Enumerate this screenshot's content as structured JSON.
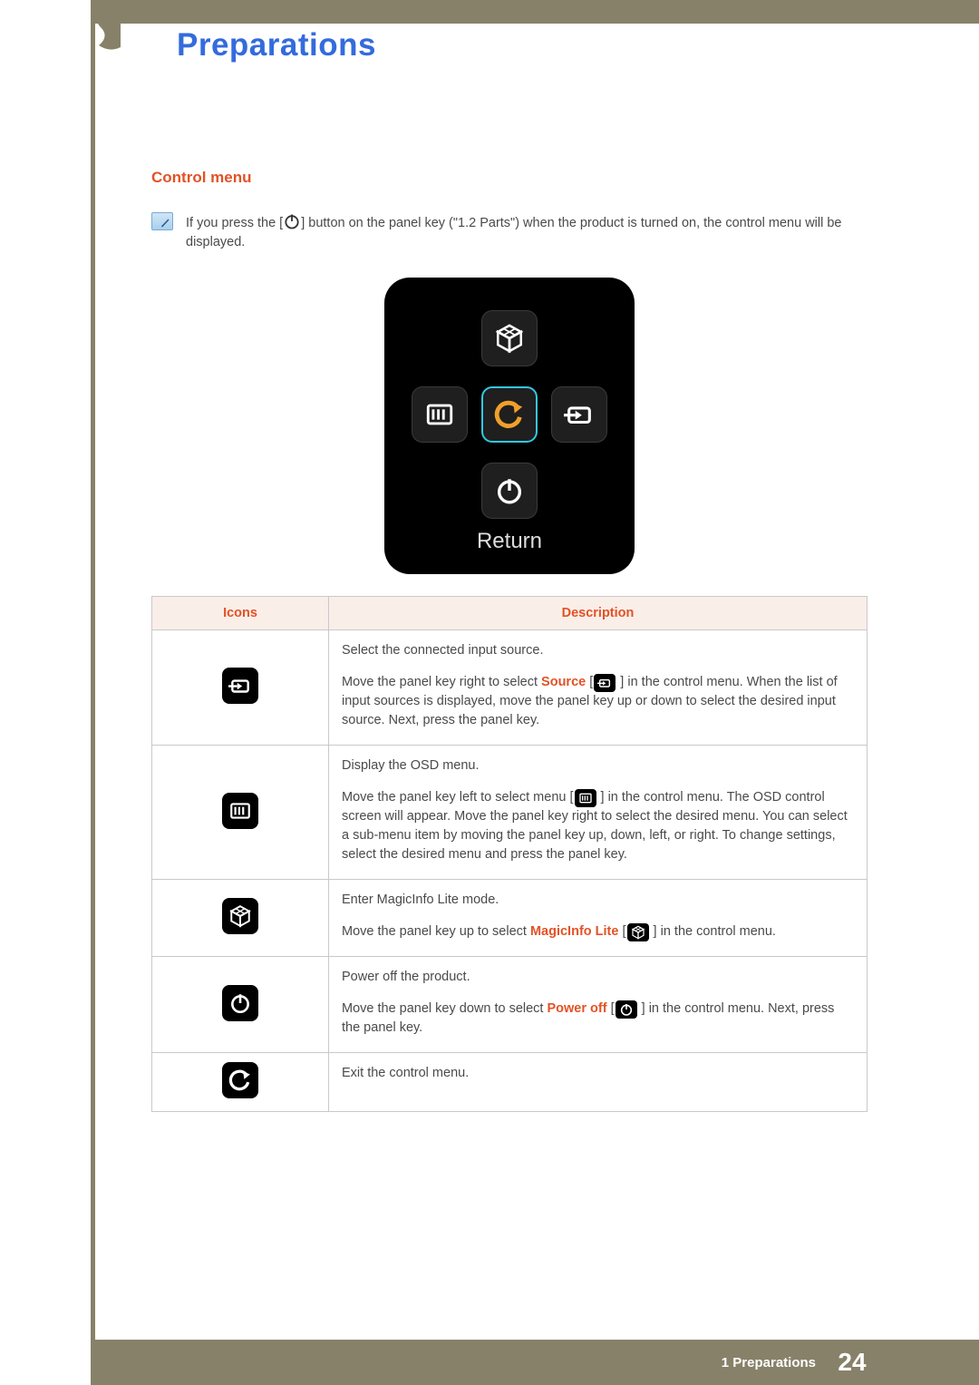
{
  "chapter_title": "Preparations",
  "section_title": "Control menu",
  "note": {
    "pre": "If you press the [",
    "post": "] button on the panel key (\"1.2 Parts\") when the product is turned on, the control menu will be displayed."
  },
  "control_panel": {
    "return_label": "Return"
  },
  "table": {
    "headers": {
      "icons": "Icons",
      "description": "Description"
    },
    "rows": [
      {
        "icon": "source",
        "line1": "Select the connected input source.",
        "pre": "Move the panel key right to select ",
        "hl": "Source",
        "post": " ] in the control menu. When the list of input sources is displayed, move the panel key up or down to select the desired input source. Next, press the panel key."
      },
      {
        "icon": "menu",
        "line1": "Display the OSD menu.",
        "pre": "Move the panel key left to select menu [",
        "post": " ] in the control menu. The OSD control screen will appear. Move the panel key right to select the desired menu. You can select a sub-menu item by moving the panel key up, down, left, or right. To change settings, select the desired menu and press the panel key."
      },
      {
        "icon": "magicinfo",
        "line1": "Enter MagicInfo Lite mode.",
        "pre": "Move the panel key up to select ",
        "hl": "MagicInfo Lite",
        "post": " ] in the control menu."
      },
      {
        "icon": "power",
        "line1": "Power off the product.",
        "pre": "Move the panel key down to select ",
        "hl": "Power off",
        "post": " ] in the control menu. Next, press the panel key."
      },
      {
        "icon": "return",
        "line1": "Exit the control menu."
      }
    ]
  },
  "footer": {
    "text": "1 Preparations",
    "page": "24"
  }
}
